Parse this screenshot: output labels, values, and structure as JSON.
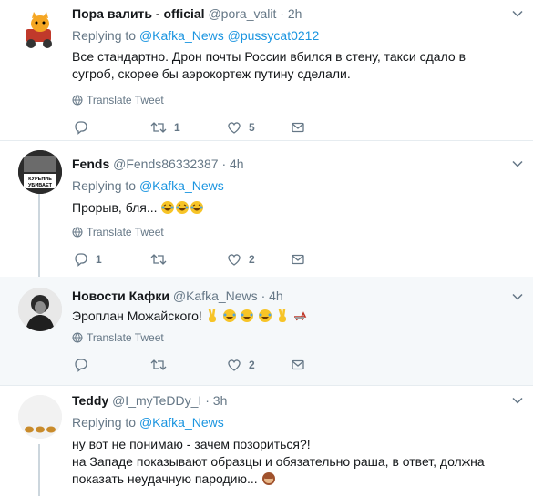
{
  "tweets": [
    {
      "name": "Пора валить - official",
      "handle": "@pora_valit",
      "time": "2h",
      "replying_label": "Replying to",
      "replying_to": "@Kafka_News @pussycat0212",
      "text": "Все стандартно. Дрон почты России вбился в стену, такси сдало в сугроб, скорее бы аэрокортеж путину сделали.",
      "translate": "Translate Tweet",
      "replies": "",
      "retweets": "1",
      "likes": "5",
      "avatar_icon": "cat-avatar-icon"
    },
    {
      "name": "Fends",
      "handle": "@Fends86332387",
      "time": "4h",
      "replying_label": "Replying to",
      "replying_to": "@Kafka_News",
      "text": "Прорыв, бля...",
      "translate": "Translate Tweet",
      "replies": "1",
      "retweets": "",
      "likes": "2",
      "avatar_icon": "cigarette-pack-avatar-icon",
      "avatar_text_1": "КУРЕНИЕ",
      "avatar_text_2": "УБИВАЕТ"
    },
    {
      "name": "Новости Кафки",
      "handle": "@Kafka_News",
      "time": "4h",
      "text": "Эроплан Можайского!",
      "translate": "Translate Tweet",
      "replies": "",
      "retweets": "",
      "likes": "2",
      "avatar_icon": "portrait-avatar-icon"
    },
    {
      "name": "Teddy",
      "handle": "@I_myTeDDy_I",
      "time": "3h",
      "replying_label": "Replying to",
      "replying_to": "@Kafka_News",
      "text_line1": "ну вот не понимаю - зачем позориться?!",
      "text_line2": "на Западе показывают образцы и обязательно раша, в ответ, должна показать неудачную пародию...",
      "avatar_icon": "teddy-avatar-icon"
    }
  ],
  "separator": "·",
  "colors": {
    "link": "#1b95e0",
    "muted": "#657786",
    "border": "#e6ecf0",
    "highlight": "#f5f8fa",
    "thread": "#ccd6dd"
  }
}
